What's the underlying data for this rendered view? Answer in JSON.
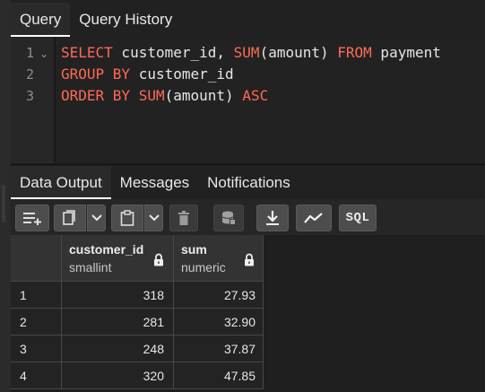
{
  "query_tabs": [
    "Query",
    "Query History"
  ],
  "editor": {
    "line_numbers": [
      "1",
      "2",
      "3"
    ],
    "lines": [
      [
        {
          "t": "SELECT",
          "k": true
        },
        {
          "t": " customer_id, ",
          "k": false
        },
        {
          "t": "SUM",
          "k": true
        },
        {
          "t": "(amount) ",
          "k": false
        },
        {
          "t": "FROM",
          "k": true
        },
        {
          "t": " payment",
          "k": false
        }
      ],
      [
        {
          "t": "GROUP BY",
          "k": true
        },
        {
          "t": " customer_id",
          "k": false
        }
      ],
      [
        {
          "t": "ORDER BY",
          "k": true
        },
        {
          "t": " ",
          "k": false
        },
        {
          "t": "SUM",
          "k": true
        },
        {
          "t": "(amount) ",
          "k": false
        },
        {
          "t": "ASC",
          "k": true
        }
      ]
    ]
  },
  "output_tabs": [
    "Data Output",
    "Messages",
    "Notifications"
  ],
  "toolbar": {
    "sql_label": "SQL",
    "icons": [
      "add-row-icon",
      "copy-icon",
      "chevron-down-icon",
      "paste-icon",
      "chevron-down-icon",
      "delete-icon",
      "save-data-icon",
      "download-icon",
      "graph-icon",
      "sql-icon"
    ]
  },
  "grid": {
    "columns": [
      {
        "name": "customer_id",
        "type": "smallint"
      },
      {
        "name": "sum",
        "type": "numeric"
      }
    ],
    "rows": [
      {
        "index": "1",
        "customer_id": "318",
        "sum": "27.93"
      },
      {
        "index": "2",
        "customer_id": "281",
        "sum": "32.90"
      },
      {
        "index": "3",
        "customer_id": "248",
        "sum": "37.87"
      },
      {
        "index": "4",
        "customer_id": "320",
        "sum": "47.85"
      }
    ]
  },
  "colors": {
    "keyword": "#ff6a55",
    "text": "#e6e6e6",
    "background": "#1e1e1e"
  }
}
